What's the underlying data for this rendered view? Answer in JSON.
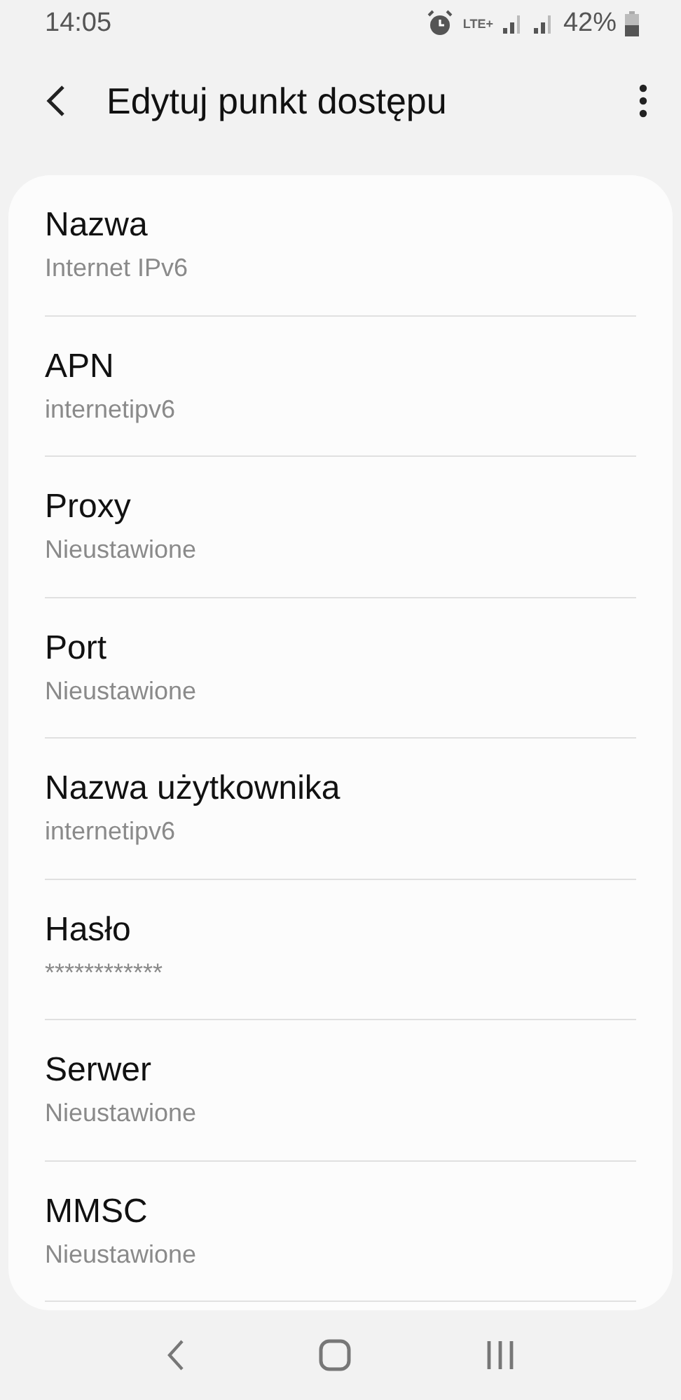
{
  "status_bar": {
    "time": "14:05",
    "network": "LTE+",
    "battery": "42%"
  },
  "header": {
    "title": "Edytuj punkt dostępu"
  },
  "fields": [
    {
      "label": "Nazwa",
      "value": "Internet IPv6"
    },
    {
      "label": "APN",
      "value": "internetipv6"
    },
    {
      "label": "Proxy",
      "value": "Nieustawione"
    },
    {
      "label": "Port",
      "value": "Nieustawione"
    },
    {
      "label": "Nazwa użytkownika",
      "value": "internetipv6"
    },
    {
      "label": "Hasło",
      "value": "************"
    },
    {
      "label": "Serwer",
      "value": "Nieustawione"
    },
    {
      "label": "MMSC",
      "value": "Nieustawione"
    }
  ]
}
